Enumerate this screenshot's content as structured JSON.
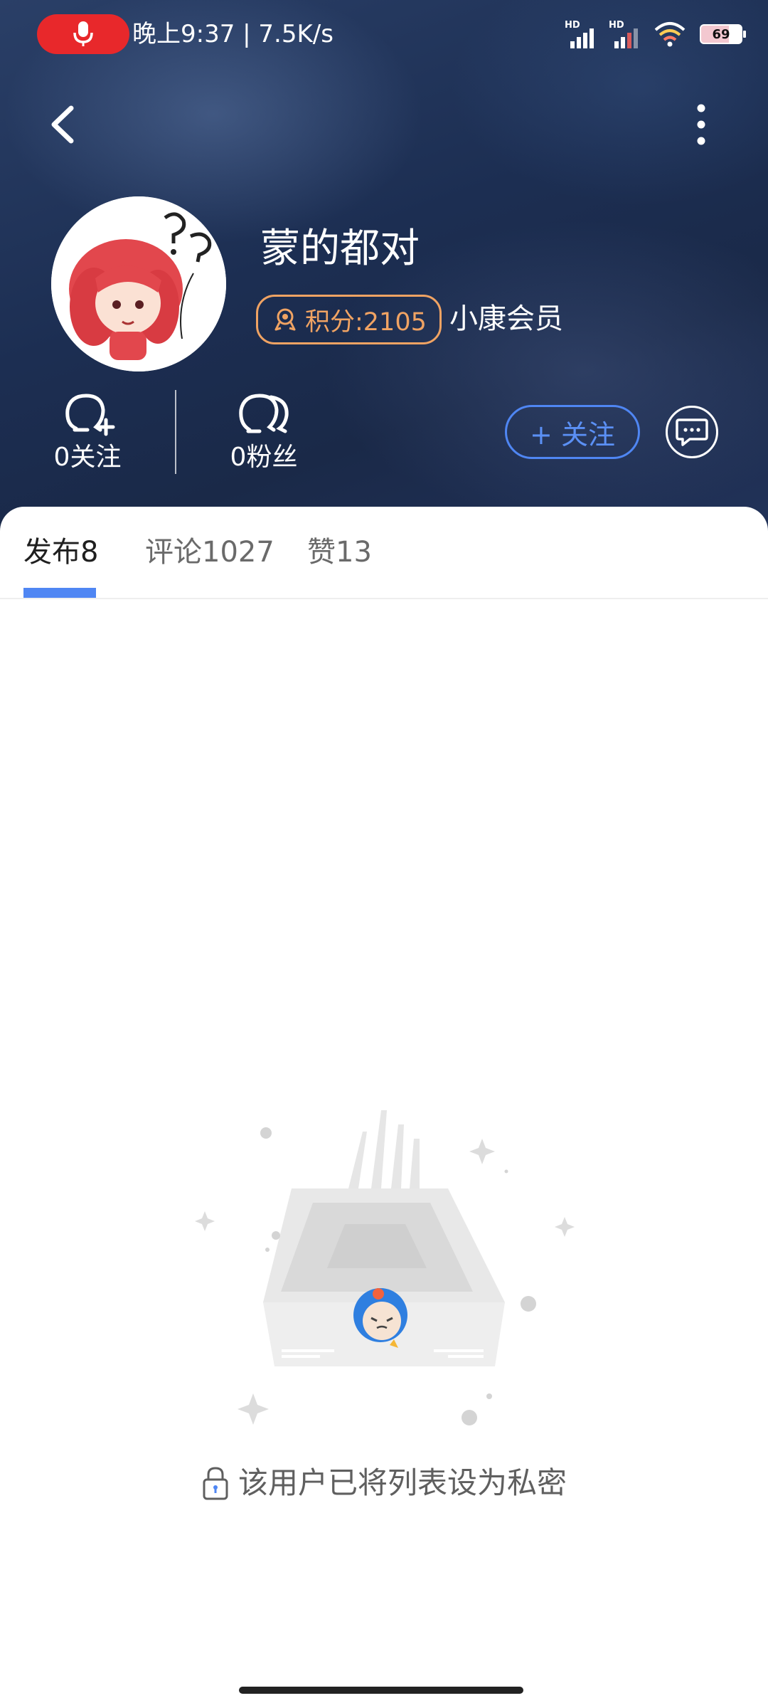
{
  "status_bar": {
    "time_text": "晚上9:37 | 7.5K/s",
    "signal1_label": "HD",
    "signal2_label": "HD",
    "battery": "69"
  },
  "profile": {
    "username": "蒙的都对",
    "points_label": "积分:2105",
    "member_label": "小康会员"
  },
  "stats": {
    "following_label": "0关注",
    "fans_label": "0粉丝"
  },
  "actions": {
    "follow_label": "+ 关注"
  },
  "tabs": [
    {
      "label": "发布8",
      "active": true
    },
    {
      "label": "评论1027",
      "active": false
    },
    {
      "label": "赞13",
      "active": false
    }
  ],
  "empty_state": {
    "message": "该用户已将列表设为私密"
  },
  "colors": {
    "accent_blue": "#4f86f3",
    "points_orange": "#f0a363",
    "mic_red": "#e8282b"
  }
}
